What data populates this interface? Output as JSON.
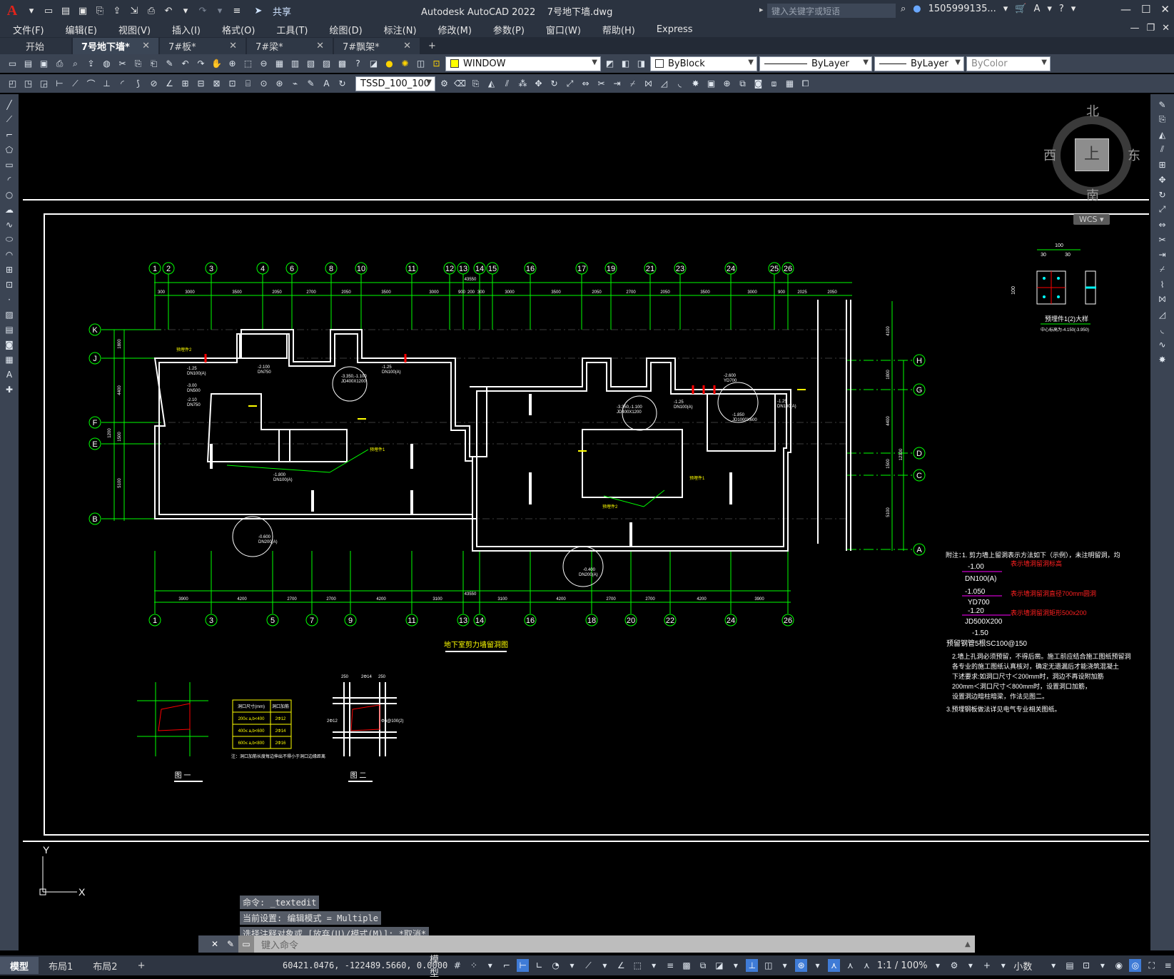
{
  "app": {
    "title": "Autodesk AutoCAD 2022",
    "document": "7号地下墙.dwg",
    "logo": "A",
    "share_label": "共享",
    "search_placeholder": "键入关键字或短语",
    "user": "1505999135...",
    "qat_icons": [
      "new-icon",
      "open-icon",
      "save-icon",
      "saveas-icon",
      "publish-icon",
      "plot-icon",
      "undo-icon",
      "redo-icon"
    ]
  },
  "menu": [
    "文件(F)",
    "编辑(E)",
    "视图(V)",
    "插入(I)",
    "格式(O)",
    "工具(T)",
    "绘图(D)",
    "标注(N)",
    "修改(M)",
    "参数(P)",
    "窗口(W)",
    "帮助(H)",
    "Express"
  ],
  "tabs": [
    {
      "label": "开始",
      "closable": false,
      "active": false
    },
    {
      "label": "7号地下墙*",
      "closable": true,
      "active": true
    },
    {
      "label": "7#板*",
      "closable": true,
      "active": false
    },
    {
      "label": "7#梁*",
      "closable": true,
      "active": false
    },
    {
      "label": "7#飘架*",
      "closable": true,
      "active": false
    }
  ],
  "toolbar": {
    "layer_name": "WINDOW",
    "color_value": "ByBlock",
    "linetype_value": "ByLayer",
    "lineweight_value": "ByLayer",
    "plotstyle_value": "ByColor",
    "dimstyle_value": "TSSD_100_100"
  },
  "viewcube": {
    "north": "北",
    "south": "南",
    "east": "东",
    "west": "西",
    "top": "上",
    "wcs": "WCS"
  },
  "drawing": {
    "title": "地下室剪力墙留洞图",
    "top_axes": [
      "1",
      "2",
      "3",
      "4",
      "6",
      "8",
      "10",
      "11",
      "12",
      "13",
      "14",
      "15",
      "16",
      "17",
      "19",
      "21",
      "23",
      "24",
      "25",
      "26"
    ],
    "bottom_axes": [
      "1",
      "3",
      "5",
      "7",
      "9",
      "11",
      "13",
      "14",
      "16",
      "18",
      "20",
      "22",
      "24",
      "26"
    ],
    "left_axes": [
      "K",
      "J",
      "F",
      "E",
      "B"
    ],
    "right_axes": [
      "H",
      "G",
      "D",
      "C",
      "A"
    ],
    "top_dims": [
      "300",
      "3000",
      "3500",
      "2050",
      "2700",
      "2050",
      "3500",
      "3000",
      "900",
      "200",
      "300",
      "3000",
      "3500",
      "2050",
      "2700",
      "2050",
      "3500",
      "3000",
      "900",
      "2025",
      "2050"
    ],
    "overall_dim": "43550",
    "bottom_dims": [
      "3900",
      "4200",
      "2700",
      "2700",
      "4200",
      "3100",
      "3100",
      "4200",
      "2700",
      "2700",
      "4200",
      "3900"
    ],
    "left_dims": [
      "1800",
      "4400",
      "1200",
      "1500",
      "5100"
    ],
    "right_dims": [
      "4100",
      "1800",
      "4400",
      "1500",
      "5100",
      "12300"
    ],
    "labels_left": [
      "-1.25",
      "DN100(A)",
      "-2.100",
      "DN750",
      "-3.00",
      "DN500",
      "-2.10",
      "DN750",
      "-1.25",
      "DN100(A)",
      "-3.350,-1.100",
      "JD400X1200",
      "-1.800",
      "DN100(A)",
      "-0.600",
      "DN200(A)",
      "预埋件2",
      "预埋件1"
    ],
    "labels_right": [
      "-3.350,-1.100",
      "JD400X1200",
      "-1.25",
      "DN100(A)",
      "-2.600",
      "YD700",
      "-1.850",
      "JD1000X600",
      "-1.25",
      "DN100(A)",
      "-0.400",
      "DN200(A)",
      "预埋件2",
      "预埋件1"
    ],
    "notes_title": "附注：",
    "notes": [
      "1. 剪力墙上留洞表示方法如下（示例），未注明留洞，均",
      "2.墙上孔洞必须预留，不得后凿。施工前应结合施工图纸预留洞",
      "  各专业的施工图纸认真核对，确定无遗漏后才能浇筑混凝土",
      "  下述要求:如洞口尺寸＜200mm时，洞边不再设附加筋",
      "  200mm＜洞口尺寸＜800mm时，设置洞口加筋，",
      "  设置洞边暗柱暗梁，作法见图二。",
      "3.预埋钢板做法详见电气专业相关图纸。"
    ],
    "legend": [
      {
        "value": "-1.00",
        "note": "表示墙洞留洞标高"
      },
      {
        "value": "DN100(A)",
        "note": ""
      },
      {
        "value": "-1.050",
        "note": ""
      },
      {
        "value": "YD700",
        "note": "表示墙洞留洞直径700mm圆洞"
      },
      {
        "value": "-1.20",
        "note": ""
      },
      {
        "value": "JD500X200",
        "note": "表示墙洞留洞矩形500x200"
      },
      {
        "value": "-1.50",
        "note": ""
      },
      {
        "value": "预留钢管5根SC100@150",
        "note": ""
      }
    ],
    "detail_title": "预埋件1(2)大样",
    "detail_sub": "中心标高为-4.150(-3.950)",
    "detail_dims": [
      "100",
      "30",
      "30",
      "100"
    ],
    "fig1_label": "图 一",
    "fig2_label": "图 二",
    "table_header": [
      "洞口尺寸(mm)",
      "洞口加筋"
    ],
    "table_rows": [
      [
        "200≤ a,b<400",
        "2Φ12"
      ],
      [
        "400≤ a,b<600",
        "2Φ14"
      ],
      [
        "600≤ a,b<800",
        "2Φ16"
      ]
    ],
    "table_note": "注：洞口加筋长度每边伸出不得小于洞口边缘距离",
    "fig2_labels": [
      "2Φ14",
      "2Φ12",
      "2Φ16",
      "Φ6@100(2)",
      "250",
      "250"
    ]
  },
  "command_history": [
    "命令: _textedit",
    "当前设置: 编辑模式 = Multiple",
    "选择注释对象或 [放弃(U)/模式(M)]: *取消*"
  ],
  "command_placeholder": "键入命令",
  "layout_tabs": [
    "模型",
    "布局1",
    "布局2"
  ],
  "status": {
    "coords": "60421.0476, -122489.5660, 0.0000",
    "space": "模型",
    "scale": "1:1 / 100%",
    "units": "小数"
  },
  "colors": {
    "title_bg": "#2b3340",
    "toolbar_bg": "#3b4453",
    "canvas_bg": "#000000",
    "axis_green": "#00ff00",
    "wall_white": "#ffffff",
    "hole_red": "#ff0000",
    "note_red": "#ff2020",
    "label_yellow": "#ffff00",
    "accent_blue": "#3f7bd6"
  }
}
